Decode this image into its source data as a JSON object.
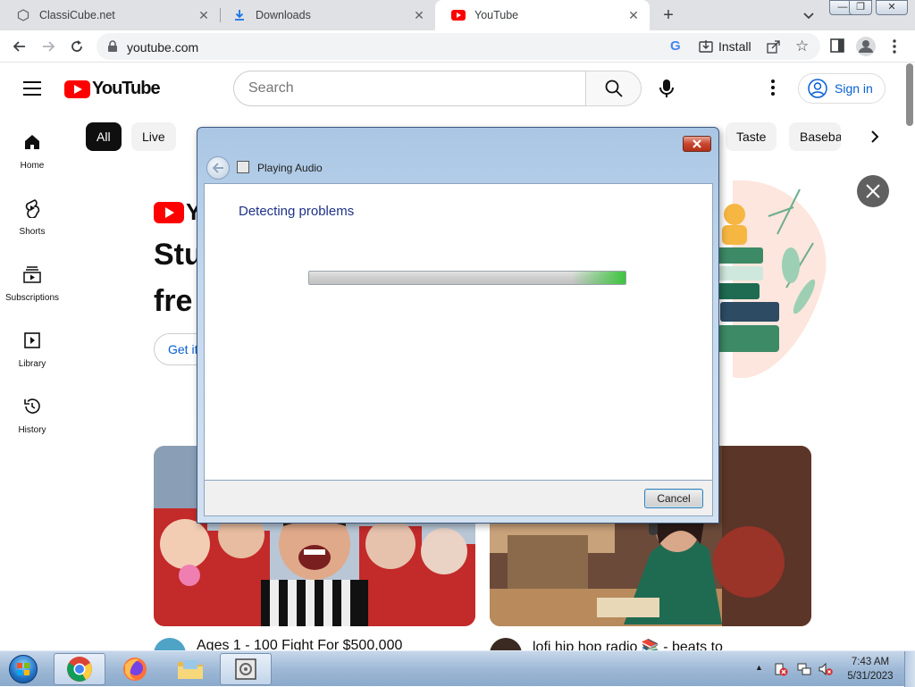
{
  "browser": {
    "tabs": [
      {
        "label": "ClassiCube.net",
        "icon": "globe-icon"
      },
      {
        "label": "Downloads",
        "icon": "download-icon"
      },
      {
        "label": "YouTube",
        "icon": "youtube-icon",
        "active": true
      }
    ],
    "url": "youtube.com",
    "install_label": "Install"
  },
  "youtube": {
    "logo_text": "YouTube",
    "search_placeholder": "Search",
    "signin_label": "Sign in",
    "chips": [
      "All",
      "Live",
      "Taste",
      "Baseba"
    ],
    "sidebar": [
      {
        "label": "Home",
        "icon": "home-icon"
      },
      {
        "label": "Shorts",
        "icon": "shorts-icon"
      },
      {
        "label": "Subscriptions",
        "icon": "subscriptions-icon"
      },
      {
        "label": "Library",
        "icon": "library-icon"
      },
      {
        "label": "History",
        "icon": "history-icon"
      }
    ],
    "promo": {
      "logo_partial": "Y",
      "title_line1": "Stu",
      "title_line2": "fre",
      "button_label": "Get it"
    },
    "videos": [
      {
        "title": "Ages 1 - 100 Fight For $500,000"
      },
      {
        "title": "lofi hip hop radio 📚 - beats to"
      }
    ]
  },
  "dialog": {
    "window_title": "Playing Audio",
    "heading": "Detecting problems",
    "progress": 1.0,
    "cancel_label": "Cancel"
  },
  "taskbar": {
    "apps": [
      "chrome-icon",
      "firefox-icon",
      "file-explorer-icon",
      "troubleshooter-icon"
    ],
    "time": "7:43 AM",
    "date": "5/31/2023"
  },
  "colors": {
    "youtube_red": "#ff0000",
    "link_blue": "#065fd4",
    "dialog_heading": "#1e3287",
    "progress_green": "#3ec43e"
  }
}
